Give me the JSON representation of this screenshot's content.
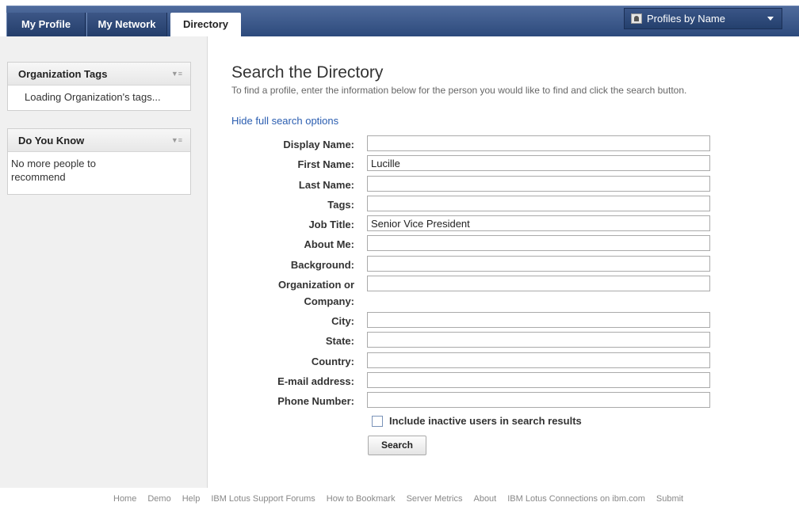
{
  "nav": {
    "tabs": [
      {
        "label": "My Profile"
      },
      {
        "label": "My Network"
      },
      {
        "label": "Directory"
      }
    ],
    "profiles_dropdown": "Profiles by Name"
  },
  "sidebar": {
    "org_tags": {
      "title": "Organization Tags",
      "body": "Loading Organization's tags..."
    },
    "do_you_know": {
      "title": "Do You Know",
      "body": "No more people to recommend"
    }
  },
  "main": {
    "title": "Search the Directory",
    "description": "To find a profile, enter the information below for the person you would like to find and click the search button.",
    "hide_link": "Hide full search options",
    "fields": [
      {
        "label": "Display Name:",
        "value": ""
      },
      {
        "label": "First Name:",
        "value": "Lucille"
      },
      {
        "label": "Last Name:",
        "value": ""
      },
      {
        "label": "Tags:",
        "value": ""
      },
      {
        "label": "Job Title:",
        "value": "Senior Vice President"
      },
      {
        "label": "About Me:",
        "value": ""
      },
      {
        "label": "Background:",
        "value": ""
      },
      {
        "label": "Organization or",
        "label2": "Company:",
        "value": ""
      },
      {
        "label": "City:",
        "value": ""
      },
      {
        "label": "State:",
        "value": ""
      },
      {
        "label": "Country:",
        "value": ""
      },
      {
        "label": "E-mail address:",
        "value": ""
      },
      {
        "label": "Phone Number:",
        "value": ""
      }
    ],
    "include_inactive_label": "Include inactive users in search results",
    "include_inactive_checked": false,
    "search_button": "Search"
  },
  "footer": {
    "links": [
      "Home",
      "Demo",
      "Help",
      "IBM Lotus Support Forums",
      "How to Bookmark",
      "Server Metrics",
      "About",
      "IBM Lotus Connections on ibm.com",
      "Submit"
    ]
  }
}
